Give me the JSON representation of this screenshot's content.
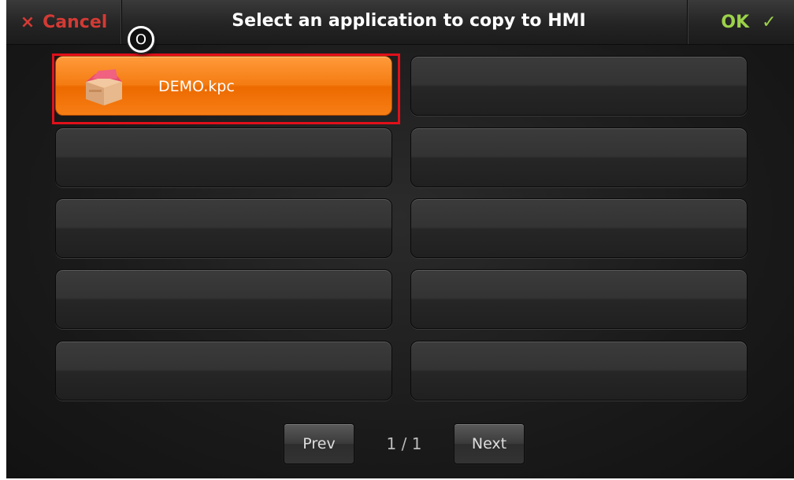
{
  "header": {
    "cancel_icon": "×",
    "cancel_label": "Cancel",
    "title": "Select an application to copy to HMI",
    "ok_label": "OK",
    "ok_icon": "✓"
  },
  "marker_label": "O",
  "apps": [
    {
      "name": "DEMO.kpc",
      "icon": "package-box-icon",
      "selected": true
    }
  ],
  "pager": {
    "prev_label": "Prev",
    "page": "1 / 1",
    "next_label": "Next"
  },
  "colors": {
    "accent_orange": "#f47c12",
    "cancel_red": "#d43a34",
    "ok_green": "#9cd24a",
    "selection_border": "#e0101a"
  }
}
